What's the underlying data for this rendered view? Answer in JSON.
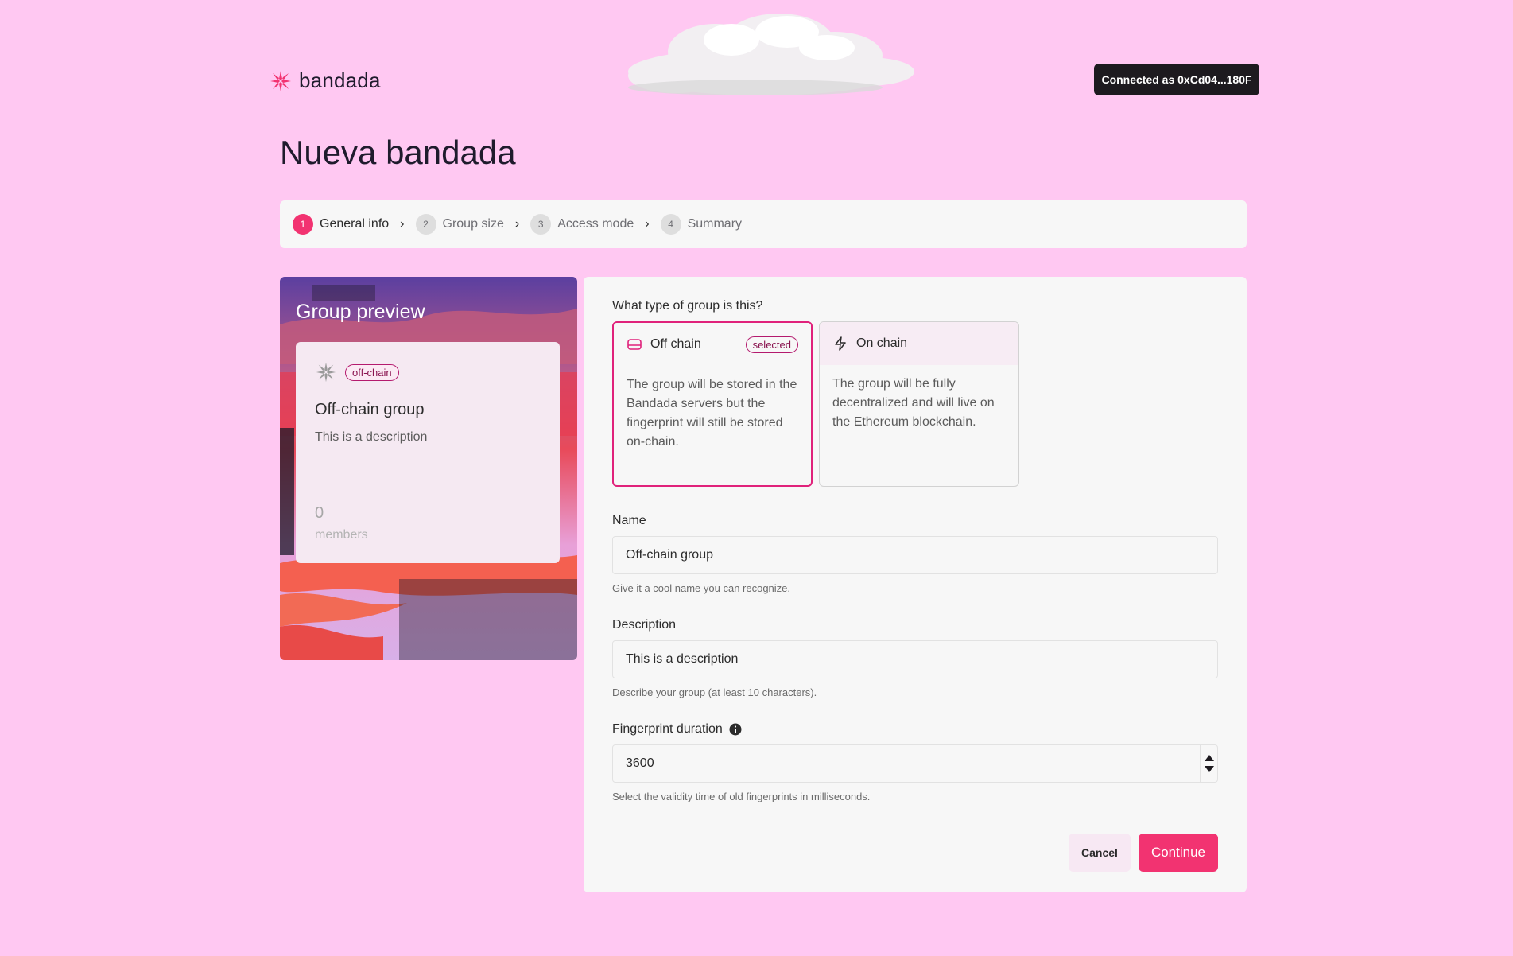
{
  "header": {
    "logo_text": "bandada",
    "connected_label": "Connected as 0xCd04...180F"
  },
  "page_title": "Nueva bandada",
  "steps": [
    {
      "num": "1",
      "label": "General info",
      "active": true
    },
    {
      "num": "2",
      "label": "Group size",
      "active": false
    },
    {
      "num": "3",
      "label": "Access mode",
      "active": false
    },
    {
      "num": "4",
      "label": "Summary",
      "active": false
    }
  ],
  "preview": {
    "title": "Group preview",
    "badge": "off-chain",
    "name": "Off-chain group",
    "description": "This is a description",
    "member_count": "0",
    "members_label": "members"
  },
  "form": {
    "type_question": "What type of group is this?",
    "types": [
      {
        "label": "Off chain",
        "badge": "selected",
        "description": "The group will be stored in the Bandada servers but the fingerprint will still be stored on-chain.",
        "icon": "database-icon"
      },
      {
        "label": "On chain",
        "description": "The group will be fully decentralized and will live on the Ethereum blockchain.",
        "icon": "lightning-icon"
      }
    ],
    "name": {
      "label": "Name",
      "value": "Off-chain group",
      "help": "Give it a cool name you can recognize."
    },
    "description": {
      "label": "Description",
      "value": "This is a description",
      "help": "Describe your group (at least 10 characters)."
    },
    "fingerprint": {
      "label": "Fingerprint duration",
      "value": "3600",
      "help": "Select the validity time of old fingerprints in milliseconds."
    },
    "cancel_label": "Cancel",
    "continue_label": "Continue"
  },
  "colors": {
    "background": "#ffc8f2",
    "accent": "#f23371",
    "selected_border": "#e0227b"
  }
}
